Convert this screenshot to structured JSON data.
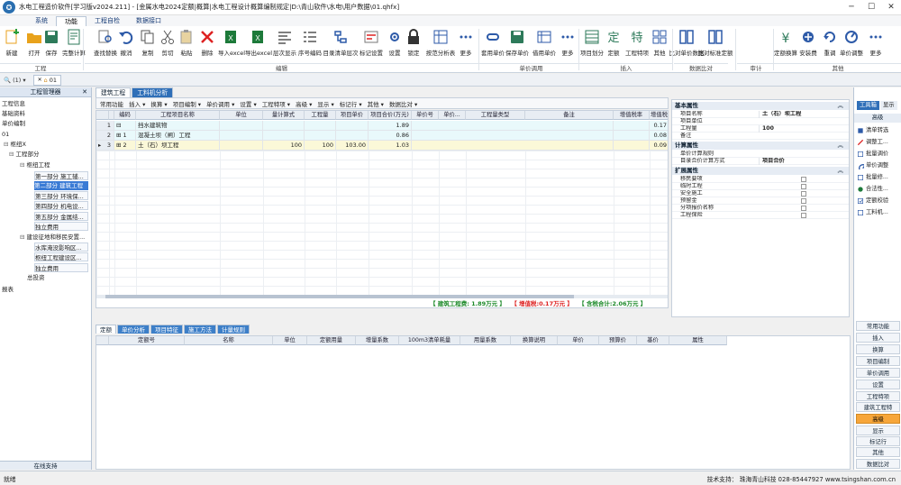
{
  "window": {
    "title": "水电工程造价软件[学习版v2024.211] - [金属水电2024定额|概算|水电工程设计概算编制规定|D:\\青山软件\\水电\\用户数据\\01.qhfx]",
    "minimize": "─",
    "maximize": "☐",
    "close": "✕"
  },
  "menu_tabs": [
    "系统",
    "功能",
    "工程自检",
    "数据接口"
  ],
  "ribbon": {
    "buttons": [
      {
        "label": "新建",
        "icon": "new-file-icon",
        "color": "#e8a21c"
      },
      {
        "label": "打开",
        "icon": "open-folder-icon",
        "color": "#e8a21c"
      },
      {
        "label": "保存",
        "icon": "save-icon",
        "color": "#2d7a5a"
      },
      {
        "label": "完整计算",
        "icon": "calculate-icon",
        "color": "#2d7a5a"
      },
      {
        "label": "查找替换",
        "icon": "find-replace-icon",
        "color": "#2d5aa8"
      },
      {
        "label": "撤消",
        "icon": "undo-icon",
        "color": "#2d5aa8"
      },
      {
        "label": "复制",
        "icon": "copy-icon",
        "color": "#555"
      },
      {
        "label": "剪切",
        "icon": "cut-icon",
        "color": "#555"
      },
      {
        "label": "粘贴",
        "icon": "paste-icon",
        "color": "#555"
      },
      {
        "label": "删除",
        "icon": "delete-icon",
        "color": "#d22"
      },
      {
        "label": "导入excel",
        "icon": "import-excel-icon",
        "color": "#1d7a3a"
      },
      {
        "label": "导出excel",
        "icon": "export-excel-icon",
        "color": "#1d7a3a"
      },
      {
        "label": "层次显示",
        "icon": "layers-icon",
        "color": "#555"
      },
      {
        "label": "序号编码",
        "icon": "numbering-icon",
        "color": "#555"
      },
      {
        "label": "目录清单层次",
        "icon": "catalog-layers-icon",
        "color": "#2d5aa8"
      },
      {
        "label": "标记设置",
        "icon": "mark-settings-icon",
        "color": "#d22"
      },
      {
        "label": "设置",
        "icon": "settings-icon",
        "color": "#2d5aa8"
      },
      {
        "label": "锁定",
        "icon": "lock-icon",
        "color": "#333"
      },
      {
        "label": "按范分析表",
        "icon": "analysis-table-icon",
        "color": "#2d5aa8"
      },
      {
        "label": "更多",
        "icon": "more-icon",
        "color": "#2d5aa8"
      },
      {
        "label": "套用单价",
        "icon": "apply-price-icon",
        "color": "#2d5aa8"
      },
      {
        "label": "保存单价",
        "icon": "save-price-icon",
        "color": "#2d7a5a"
      },
      {
        "label": "借用单价",
        "icon": "borrow-price-icon",
        "color": "#2d5aa8"
      },
      {
        "label": "更多",
        "icon": "more-icon",
        "color": "#2d5aa8"
      },
      {
        "label": "项目划分",
        "icon": "project-division-icon",
        "color": "#2d7a5a"
      },
      {
        "label": "定额",
        "icon": "quota-icon",
        "color": "#2d7a5a"
      },
      {
        "label": "工程特项",
        "icon": "special-item-icon",
        "color": "#2d7a5a"
      },
      {
        "label": "其他",
        "icon": "other-icon",
        "color": "#2d5aa8"
      },
      {
        "label": "比对单价数据",
        "icon": "compare-price-icon",
        "color": "#2d5aa8"
      },
      {
        "label": "比对标准定额",
        "icon": "compare-quota-icon",
        "color": "#2d5aa8"
      },
      {
        "label": "定额换算",
        "icon": "quota-convert-icon",
        "color": "#2d7a5a"
      },
      {
        "label": "安装费",
        "icon": "install-fee-icon",
        "color": "#2d5aa8"
      },
      {
        "label": "重调",
        "icon": "readjust-icon",
        "color": "#2d5aa8"
      },
      {
        "label": "单价调整",
        "icon": "price-adjust-icon",
        "color": "#2d5aa8"
      },
      {
        "label": "更多",
        "icon": "more-icon",
        "color": "#2d5aa8"
      }
    ],
    "groups": [
      "工程",
      "编辑",
      "单价调用",
      "插入",
      "数据比对",
      "审计",
      "其他"
    ]
  },
  "doc_tabs": {
    "dropdown": "(1)",
    "tab_label": "01"
  },
  "left_panel": {
    "title": "工程管理器",
    "close": "✕",
    "items": [
      {
        "label": "工程信息"
      },
      {
        "label": "基础资料"
      },
      {
        "label": "单价编制"
      },
      {
        "label": "01"
      },
      {
        "label": "枢纽X"
      },
      {
        "label": "工程部分"
      },
      {
        "label": "枢纽工程"
      },
      {
        "label": "第一部分 施工辅..."
      },
      {
        "label": "第二部分 建筑工程"
      },
      {
        "label": "第三部分 环境保..."
      },
      {
        "label": "第四部分 机电设..."
      },
      {
        "label": "第五部分 金属结..."
      },
      {
        "label": "独立费用"
      },
      {
        "label": "建设征地和移民安置..."
      },
      {
        "label": "水库淹没影响区..."
      },
      {
        "label": "枢纽工程建设区..."
      },
      {
        "label": "独立费用"
      },
      {
        "label": "总投资"
      },
      {
        "label": "报表"
      }
    ],
    "footer": "在线支持"
  },
  "main_tabs": [
    "建筑工程",
    "工料机分析"
  ],
  "sub_toolbar": [
    "常用功能",
    "插入",
    "换算",
    "项目编制",
    "单价调用",
    "设置",
    "工程特项",
    "高级",
    "显示",
    "标记行",
    "其他",
    "数据比对"
  ],
  "grid": {
    "headers": [
      "编码",
      "工程项目名称",
      "单位",
      "量计算式",
      "工程量",
      "项目单价",
      "项目合价(万元)",
      "单价号",
      "单价...",
      "工程量类型",
      "备注",
      "增值税率",
      "增值税"
    ],
    "rows": [
      {
        "idx": "1",
        "code": "",
        "name": "挡水建筑物",
        "unit": "",
        "formula": "",
        "qty": "",
        "price": "",
        "total": "1.89",
        "tax": "0.17"
      },
      {
        "idx": "2",
        "code": "1",
        "name": "混凝土坝（闸）工程",
        "unit": "",
        "formula": "",
        "qty": "",
        "price": "",
        "total": "0.86",
        "tax": "0.08"
      },
      {
        "idx": "3",
        "code": "2",
        "name": "土（石）坝工程",
        "unit": "",
        "formula": "100",
        "qty": "100",
        "price": "103.00",
        "total": "1.03",
        "tax": "0.09"
      }
    ],
    "sum_building": "【 建筑工程费: 1.89万元 】",
    "sum_tax": "【 增值税:0.17万元 】",
    "sum_total": "【 含税合计:2.06万元 】"
  },
  "props": {
    "sections": [
      {
        "title": "基本属性",
        "rows": [
          {
            "k": "项目名称",
            "v": "土（石）坝工程"
          },
          {
            "k": "项目单位",
            "v": ""
          },
          {
            "k": "工程量",
            "v": "100"
          },
          {
            "k": "备注",
            "v": ""
          }
        ]
      },
      {
        "title": "计算属性",
        "rows": [
          {
            "k": "单价计算规则",
            "v": ""
          },
          {
            "k": "目录合价计算方式",
            "v": "项目合价"
          }
        ]
      },
      {
        "title": "扩展属性",
        "rows": [
          {
            "k": "移民要项",
            "v": ""
          },
          {
            "k": "临时工程",
            "v": ""
          },
          {
            "k": "安全施工",
            "v": ""
          },
          {
            "k": "预留金",
            "v": ""
          },
          {
            "k": "分项报价名称",
            "v": ""
          },
          {
            "k": "工程保险",
            "v": ""
          }
        ]
      }
    ],
    "arrow": "︽"
  },
  "toolbox": {
    "tabs": [
      "工具箱",
      "显示"
    ],
    "section": "高级",
    "items": [
      {
        "label": "清单转选",
        "icon": "list-transfer-icon",
        "color": "#2d5aa8"
      },
      {
        "label": "调整工...",
        "icon": "adjust-icon",
        "color": "#d22"
      },
      {
        "label": "批量调价",
        "icon": "batch-price-icon",
        "color": "#2d5aa8"
      },
      {
        "label": "单价调整",
        "icon": "price-adjust-icon",
        "color": "#2d5aa8"
      },
      {
        "label": "批量修...",
        "icon": "batch-edit-icon",
        "color": "#2d5aa8"
      },
      {
        "label": "合法性...",
        "icon": "validity-icon",
        "color": "#1d7a3a"
      },
      {
        "label": "定额校验",
        "icon": "quota-check-icon",
        "color": "#2d5aa8"
      },
      {
        "label": "工料机...",
        "icon": "material-icon",
        "color": "#2d5aa8"
      }
    ],
    "buttons": [
      "常用功能",
      "插入",
      "换算",
      "项目编制",
      "单价调用",
      "设置",
      "工程特项",
      "建筑工程特",
      "高级",
      "显示",
      "标记行",
      "其他",
      "数据比对"
    ]
  },
  "bottom_tabs": [
    "定额",
    "单价分析",
    "项目特征",
    "施工方法",
    "计量规则"
  ],
  "bottom_grid": {
    "headers": [
      "定额号",
      "名称",
      "单位",
      "定额用量",
      "增量系数",
      "100m3清单耗量",
      "用量系数",
      "换算说明",
      "单价",
      "预算价",
      "基价",
      "属性"
    ]
  },
  "status": {
    "left": "就绪",
    "right": "技术支持：  珠海青山科技  028-85447927  www.tsingshan.com.cn"
  }
}
